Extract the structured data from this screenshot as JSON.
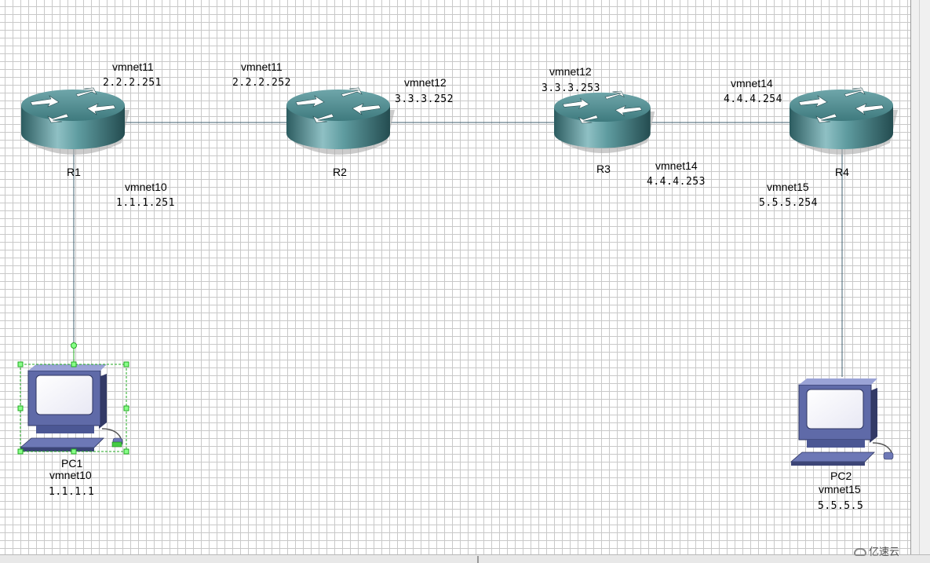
{
  "routers": [
    {
      "name": "R1"
    },
    {
      "name": "R2"
    },
    {
      "name": "R3"
    },
    {
      "name": "R4"
    }
  ],
  "pcs": [
    {
      "name": "PC1",
      "vmnet": "vmnet10",
      "ip": "1.1.1.1"
    },
    {
      "name": "PC2",
      "vmnet": "vmnet15",
      "ip": "5.5.5.5"
    }
  ],
  "interfaces": {
    "r1_r2_r1side": {
      "vmnet": "vmnet11",
      "ip": "2.2.2.251"
    },
    "r1_r2_r2side": {
      "vmnet": "vmnet11",
      "ip": "2.2.2.252"
    },
    "r2_r3_r2side": {
      "vmnet": "vmnet12",
      "ip": "3.3.3.252"
    },
    "r2_r3_r3side": {
      "vmnet": "vmnet12",
      "ip": "3.3.3.253"
    },
    "r3_r4_r4side": {
      "vmnet": "vmnet14",
      "ip": "4.4.4.254"
    },
    "r3_r4_r3side": {
      "vmnet": "vmnet14",
      "ip": "4.4.4.253"
    },
    "r1_pc1_r1side": {
      "vmnet": "vmnet10",
      "ip": "1.1.1.251"
    },
    "r4_pc2_r4side": {
      "vmnet": "vmnet15",
      "ip": "5.5.5.254"
    }
  },
  "watermark": "亿速云",
  "colors": {
    "link": "#3f5f6f",
    "router_body": "#3c7c80",
    "pc_body": "#4b5794",
    "selection": "#22aa22"
  }
}
